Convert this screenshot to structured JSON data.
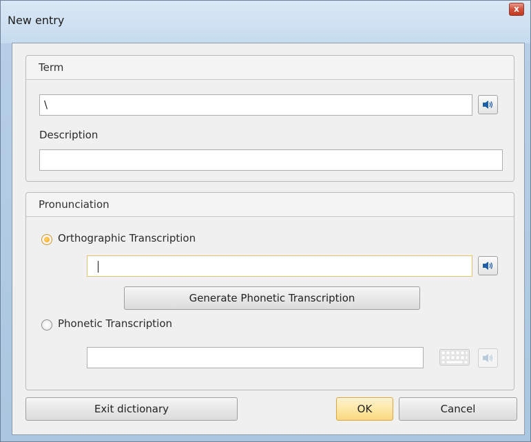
{
  "window": {
    "title": "New entry",
    "close_label": "x"
  },
  "term_group": {
    "header": "Term",
    "term_value": "\\",
    "description_label": "Description",
    "description_value": ""
  },
  "pronunciation_group": {
    "header": "Pronunciation",
    "orthographic": {
      "label": "Orthographic Transcription",
      "selected": true,
      "value": ""
    },
    "generate_button_label": "Generate Phonetic Transcription",
    "phonetic": {
      "label": "Phonetic Transcription",
      "selected": false,
      "value": ""
    }
  },
  "footer": {
    "exit_label": "Exit dictionary",
    "ok_label": "OK",
    "cancel_label": "Cancel"
  },
  "colors": {
    "speaker_icon": "#1f5fa8",
    "speaker_icon_disabled": "#b8c9dc",
    "default_button": "#fde6a4",
    "focus_border": "#e5c365"
  }
}
